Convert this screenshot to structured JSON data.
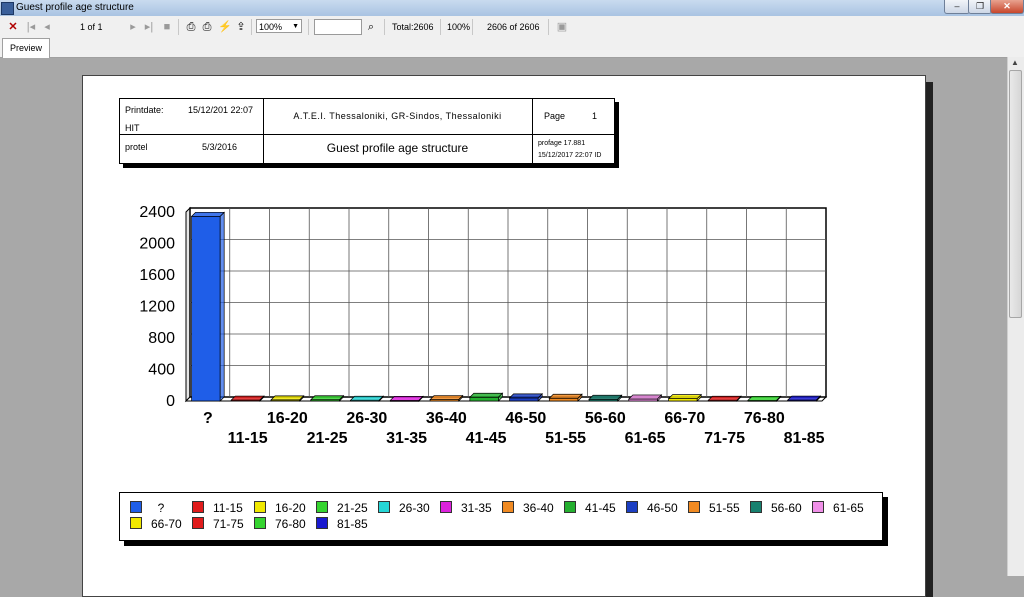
{
  "window": {
    "title": "Guest profile age structure",
    "minimize_glyph": "–",
    "restore_glyph": "❐",
    "close_glyph": "✕"
  },
  "toolbar": {
    "page_indicator": "1 of 1",
    "zoom_value": "100%",
    "zoom_options": [
      "100%"
    ],
    "search_value": "",
    "total": "Total:2606",
    "percent": "100%",
    "count": "2606 of 2606",
    "icons": [
      "close-icon",
      "first-page-icon",
      "prev-page-icon",
      "next-page-icon",
      "last-page-icon",
      "stop-icon",
      "print-icon",
      "print-setup-icon",
      "lightning-icon",
      "export-icon",
      "binoculars-icon",
      "disk-icon"
    ]
  },
  "tabs": [
    {
      "label": "Preview"
    }
  ],
  "report": {
    "printdate_label": "Printdate:",
    "printdate_value": "15/12/201 22:07",
    "company": "HIT",
    "system": "protel",
    "version_date": "5/3/2016",
    "hotel": "A.T.E.I. Thessaloniki, GR-Sindos, Thessaloniki",
    "report_title": "Guest profile age structure",
    "page_label": "Page",
    "page_number": "1",
    "profile_code": "profage 17.881",
    "timestamp_id": "15/12/2017 22:07   ID"
  },
  "chart_data": {
    "type": "bar",
    "categories": [
      "?",
      "11-15",
      "16-20",
      "21-25",
      "26-30",
      "31-35",
      "36-40",
      "41-45",
      "46-50",
      "51-55",
      "56-60",
      "61-65",
      "66-70",
      "71-75",
      "76-80",
      "81-85"
    ],
    "values": [
      2345,
      12,
      14,
      16,
      10,
      8,
      18,
      48,
      40,
      35,
      22,
      25,
      30,
      10,
      9,
      12
    ],
    "colors": [
      "#1f5ee8",
      "#e01c1c",
      "#f0e800",
      "#35d430",
      "#25d6d6",
      "#dd22dd",
      "#f08a22",
      "#25b030",
      "#1c3fc2",
      "#f08a22",
      "#17806f",
      "#f090e8",
      "#f0e800",
      "#e01c1c",
      "#35d430",
      "#1a1ad0"
    ],
    "yticks": [
      0,
      400,
      800,
      1200,
      1600,
      2000,
      2400
    ],
    "ylim": [
      0,
      2400
    ],
    "grid": true,
    "legend": "bottom"
  }
}
